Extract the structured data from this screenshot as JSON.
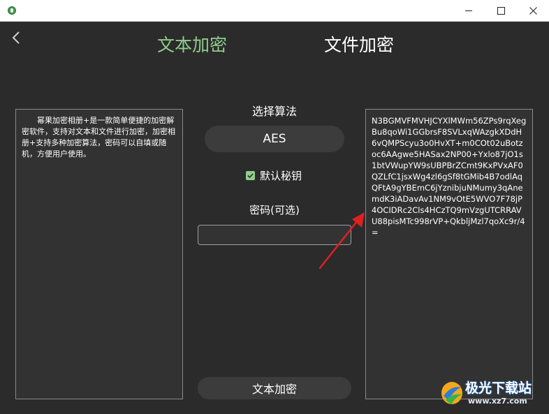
{
  "window": {
    "minimize_icon": "minimize-icon",
    "maximize_icon": "maximize-icon",
    "close_icon": "close-icon"
  },
  "nav": {
    "back_icon": "chevron-left-icon"
  },
  "tabs": [
    {
      "label": "文本加密",
      "active": true
    },
    {
      "label": "文件加密",
      "active": false
    }
  ],
  "input_text": "幂果加密相册+是一款简单便捷的加密解密软件，支持对文本和文件进行加密，加密相册+支持多种加密算法，密码可以自填或随机，方便用户使用。",
  "algorithm": {
    "label": "选择算法",
    "selected": "AES"
  },
  "default_key": {
    "label": "默认秘钥",
    "checked": true
  },
  "password": {
    "label": "密码(可选)",
    "value": "",
    "placeholder": ""
  },
  "action_button": "文本加密",
  "output_text": "N3BGMVFMVHJCYXlMWm56ZPs9rqXegBu8qoWi1GGbrsF8SVLxqWAzgkXDdH6vQMPScyu3o0HvXT+m0COt02uBotzoc6AAgwe5HASax2NP00+Yxlo87jO1s1btVWupYW9sUBPBrZCmt9KxPVxAF0QZLfC1jsxWg4zl6gSf8tGMib4B7odlAqQFtA9gYBEmC6jYznibjuNMumy3qAnemdK3iADavAv1NM9vOtE5WVO7F78jP4OCIDRc2Cls4HCzTQ9mVzgUTCRRAVU88pisMTc998rVP+QkbljMzl7qoXc9r/4=",
  "watermark": {
    "name": "极光下载站",
    "url": "www.xz7.com"
  },
  "colors": {
    "accent": "#8fce8b",
    "background": "#2b2b2b",
    "arrow": "#e02020"
  }
}
